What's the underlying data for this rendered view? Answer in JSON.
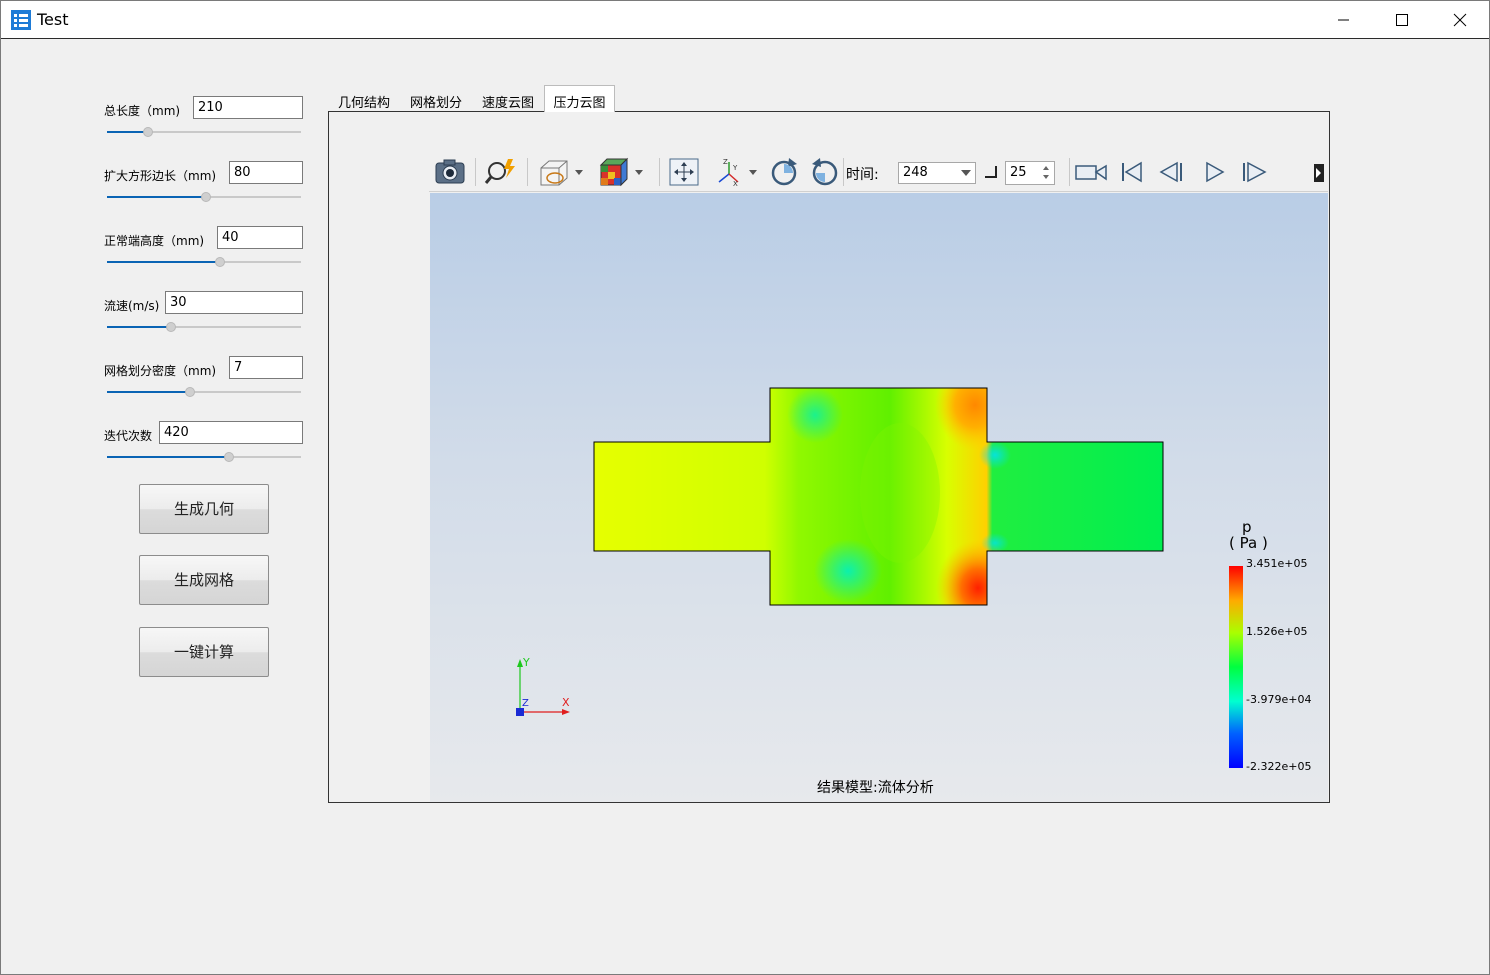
{
  "window": {
    "title": "Test",
    "controls": [
      "minimize-icon",
      "maximize-icon",
      "close-icon"
    ]
  },
  "params": [
    {
      "label": "总长度（mm)",
      "value": "210",
      "slider": 0.21
    },
    {
      "label": "扩大方形边长（mm)",
      "value": "80",
      "slider": 0.51
    },
    {
      "label": "正常端高度（mm)",
      "value": "40",
      "slider": 0.58
    },
    {
      "label": "流速(m/s)",
      "value": "30",
      "slider": 0.33
    },
    {
      "label": "网格划分密度（mm)",
      "value": "7",
      "slider": 0.43
    },
    {
      "label": "迭代次数",
      "value": "420",
      "slider": 0.63
    }
  ],
  "actions": {
    "gen_geometry": "生成几何",
    "gen_mesh": "生成网格",
    "compute": "一键计算"
  },
  "tabs": [
    "几何结构",
    "网格划分",
    "速度云图",
    "压力云图"
  ],
  "active_tab": "压力云图",
  "toolbar": {
    "time_label": "时间:",
    "time_value": "248",
    "step_value": "25",
    "icons": [
      "camera-icon",
      "zoom-icon",
      "display-mode-icon",
      "color-cube-icon",
      "fit-view-icon",
      "axes-view-icon",
      "rotate-cw-icon",
      "rotate-ccw-icon",
      "record-icon",
      "first-frame-icon",
      "prev-frame-icon",
      "play-icon",
      "next-frame-icon"
    ]
  },
  "colorbar": {
    "title_line1": "p",
    "title_line2": "( Pa )",
    "ticks": [
      "3.451e+05",
      "1.526e+05",
      "-3.979e+04",
      "-2.322e+05"
    ]
  },
  "axes": {
    "x": "X",
    "y": "Y",
    "z": "Z"
  },
  "result_label": "结果模型:流体分析"
}
